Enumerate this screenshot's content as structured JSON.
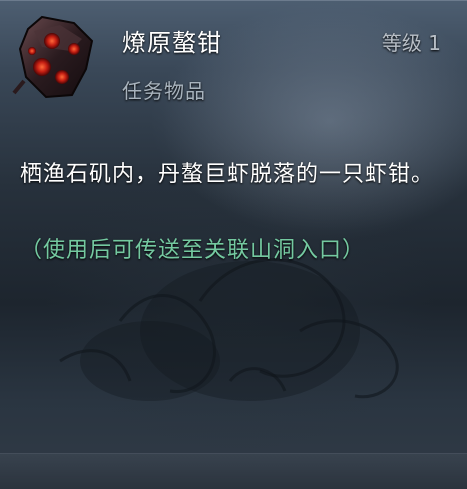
{
  "tooltip": {
    "item_name": "燎原螯钳",
    "level_text": "等级 1",
    "item_type": "任务物品",
    "description": "栖渔石矶内，丹螯巨虾脱落的一只虾钳。",
    "usage_hint": "（使用后可传送至关联山洞入口）",
    "icon": "red-claw-item-icon"
  },
  "colors": {
    "name": "#ffffff",
    "level": "#b8bfc7",
    "type": "#a8b3bd",
    "description": "#ffffff",
    "usage_hint": "#74c9a0"
  }
}
